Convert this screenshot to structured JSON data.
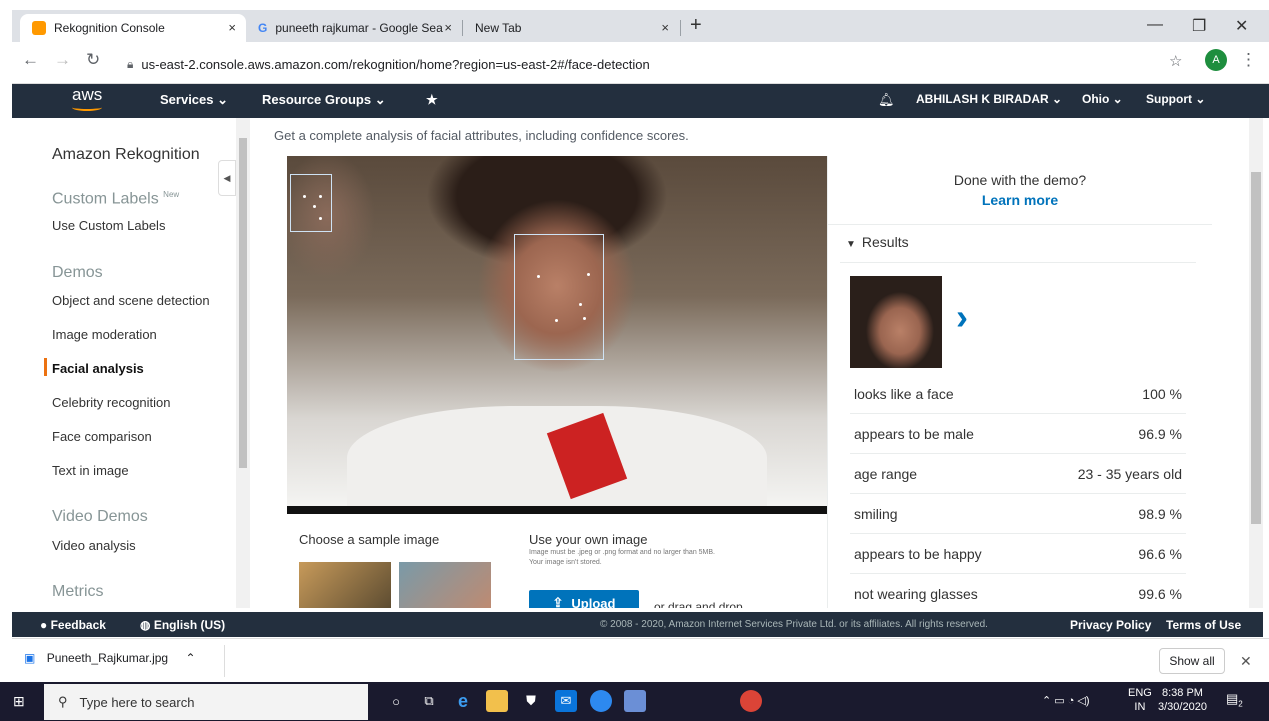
{
  "browser": {
    "tabs": [
      {
        "title": "Rekognition Console",
        "close": "×"
      },
      {
        "title": "puneeth rajkumar - Google Searc",
        "close": "×"
      },
      {
        "title": "New Tab",
        "close": "×"
      }
    ],
    "new_tab": "+",
    "url": "us-east-2.console.aws.amazon.com/rekognition/home?region=us-east-2#/face-detection",
    "profile_initial": "A"
  },
  "aws_nav": {
    "logo": "aws",
    "services": "Services",
    "resource_groups": "Resource Groups",
    "user": "ABHILASH K BIRADAR",
    "region": "Ohio",
    "support": "Support"
  },
  "sidebar": {
    "title": "Amazon Rekognition",
    "custom_labels": "Custom Labels",
    "new_badge": "New",
    "use_custom_labels": "Use Custom Labels",
    "demos": "Demos",
    "demo_items": [
      "Object and scene detection",
      "Image moderation",
      "Facial analysis",
      "Celebrity recognition",
      "Face comparison",
      "Text in image"
    ],
    "video_demos": "Video Demos",
    "video_analysis": "Video analysis",
    "metrics": "Metrics"
  },
  "main": {
    "subtitle": "Get a complete analysis of facial attributes, including confidence scores.",
    "sample_title": "Choose a sample image",
    "own_title": "Use your own image",
    "own_hint": "Image must be .jpeg or .png format and no larger than 5MB. Your image isn't stored.",
    "upload": "Upload",
    "drag": "or drag and drop"
  },
  "results": {
    "done": "Done with the demo?",
    "learn_more": "Learn more",
    "header": "Results",
    "rows": [
      {
        "name": "looks like a face",
        "value": "100 %"
      },
      {
        "name": "appears to be male",
        "value": "96.9 %"
      },
      {
        "name": "age range",
        "value": "23 - 35 years old"
      },
      {
        "name": "smiling",
        "value": "98.9 %"
      },
      {
        "name": "appears to be happy",
        "value": "96.6 %"
      },
      {
        "name": "not wearing glasses",
        "value": "99.6 %"
      }
    ]
  },
  "footer": {
    "feedback": "Feedback",
    "language": "English (US)",
    "copyright": "© 2008 - 2020, Amazon Internet Services Private Ltd. or its affiliates. All rights reserved.",
    "privacy": "Privacy Policy",
    "terms": "Terms of Use"
  },
  "downloads": {
    "file": "Puneeth_Rajkumar.jpg",
    "show_all": "Show all"
  },
  "taskbar": {
    "search_placeholder": "Type here to search",
    "lang_top": "ENG",
    "lang_bottom": "IN",
    "time": "8:38 PM",
    "date": "3/30/2020",
    "notif_count": "2"
  },
  "colors": {
    "aws_dark": "#232f3e",
    "aws_orange": "#ec7211",
    "link_blue": "#0073bb"
  }
}
